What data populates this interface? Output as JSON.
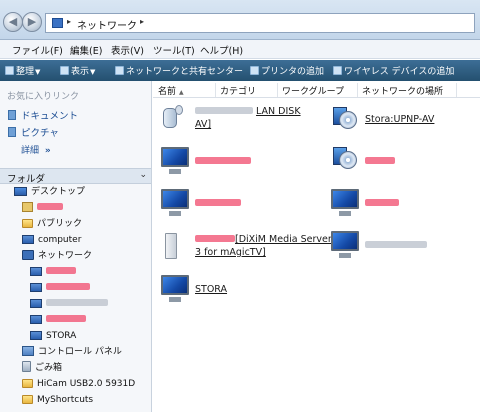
{
  "address_bar": {
    "path": "ネットワーク",
    "arrow": "▸"
  },
  "menu": [
    {
      "label": "ファイル(F)"
    },
    {
      "label": "編集(E)"
    },
    {
      "label": "表示(V)"
    },
    {
      "label": "ツール(T)"
    },
    {
      "label": "ヘルプ(H)"
    }
  ],
  "command_bar": {
    "organize": "整理",
    "view": "表示",
    "network_sharing": "ネットワークと共有センター",
    "add_printer": "プリンタの追加",
    "add_wireless": "ワイヤレス デバイスの追加",
    "dropdown": "▼"
  },
  "favorites": {
    "heading": "お気に入りリンク",
    "items": [
      {
        "label": "ドキュメント"
      },
      {
        "label": "ピクチャ"
      }
    ],
    "details": "詳細",
    "details_chevron": "»"
  },
  "folders": {
    "heading": "フォルダ",
    "chevron": "⌄",
    "tree": [
      {
        "label": "デスクトップ"
      },
      {
        "label": ""
      },
      {
        "label": "パブリック"
      },
      {
        "label": "computer"
      },
      {
        "label": "ネットワーク"
      },
      {
        "label": ""
      },
      {
        "label": ""
      },
      {
        "label": ""
      },
      {
        "label": ""
      },
      {
        "label": "STORA"
      },
      {
        "label": "コントロール パネル"
      },
      {
        "label": "ごみ箱"
      },
      {
        "label": "HiCam USB2.0 5931D"
      },
      {
        "label": "MyShortcuts"
      }
    ]
  },
  "columns": [
    {
      "label": "名前",
      "arrow": "▲"
    },
    {
      "label": "カテゴリ"
    },
    {
      "label": "ワークグループ"
    },
    {
      "label": "ネットワークの場所"
    }
  ],
  "devices": [
    {
      "label_line1": "LAN DISK",
      "label_line2": "AV]"
    },
    {
      "label_line1": "Stora:UPNP-AV",
      "label_line2": ""
    },
    {
      "label_line1": "",
      "label_line2": ""
    },
    {
      "label_line1": "",
      "label_line2": ""
    },
    {
      "label_line1": "",
      "label_line2": ""
    },
    {
      "label_line1": "",
      "label_line2": ""
    },
    {
      "label_line1": "[DiXiM Media Server",
      "label_line2": "3 for mAgicTV]"
    },
    {
      "label_line1": "",
      "label_line2": ""
    },
    {
      "label_line1": "STORA",
      "label_line2": ""
    }
  ]
}
